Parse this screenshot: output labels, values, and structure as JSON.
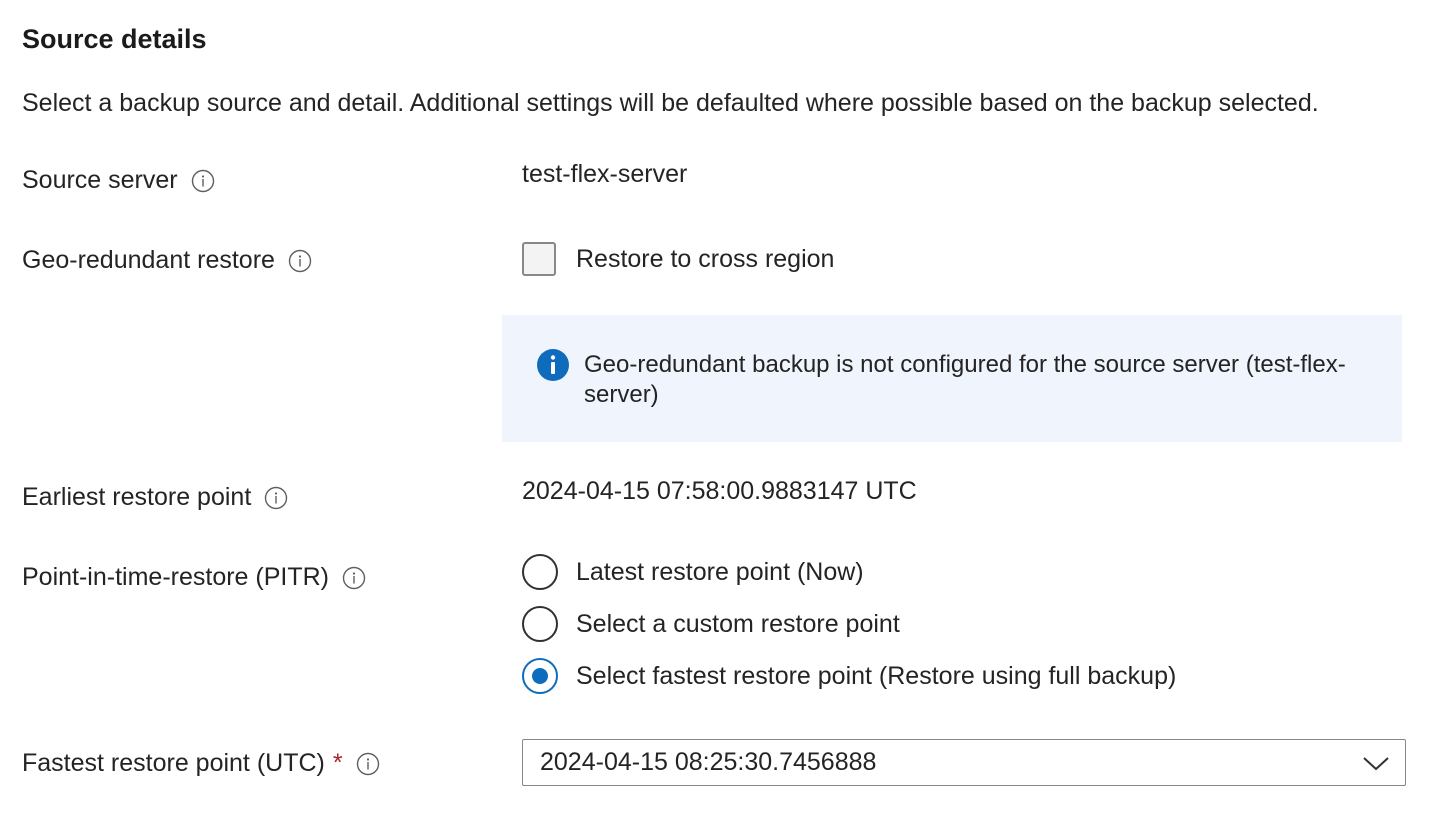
{
  "section": {
    "title": "Source details",
    "description": "Select a backup source and detail. Additional settings will be defaulted where possible based on the backup selected."
  },
  "source_server": {
    "label": "Source server",
    "value": "test-flex-server"
  },
  "geo_redundant": {
    "label": "Geo-redundant restore",
    "checkbox_label": "Restore to cross region",
    "checked": false,
    "info_message": "Geo-redundant backup is not configured for the source server (test-flex-server)"
  },
  "earliest_restore": {
    "label": "Earliest restore point",
    "value": "2024-04-15 07:58:00.9883147 UTC"
  },
  "pitr": {
    "label": "Point-in-time-restore (PITR)",
    "options": [
      {
        "label": "Latest restore point (Now)",
        "selected": false
      },
      {
        "label": "Select a custom restore point",
        "selected": false
      },
      {
        "label": "Select fastest restore point (Restore using full backup)",
        "selected": true
      }
    ]
  },
  "fastest_restore": {
    "label": "Fastest restore point (UTC)",
    "required_marker": "*",
    "selected_value": "2024-04-15 08:25:30.7456888"
  },
  "colors": {
    "accent": "#0f6cbd",
    "info_background": "#eff4fd",
    "required": "#a4262c"
  },
  "icons": {
    "info": "info-circle-outline-icon",
    "banner": "info-filled-icon",
    "dropdown": "chevron-down-icon"
  }
}
